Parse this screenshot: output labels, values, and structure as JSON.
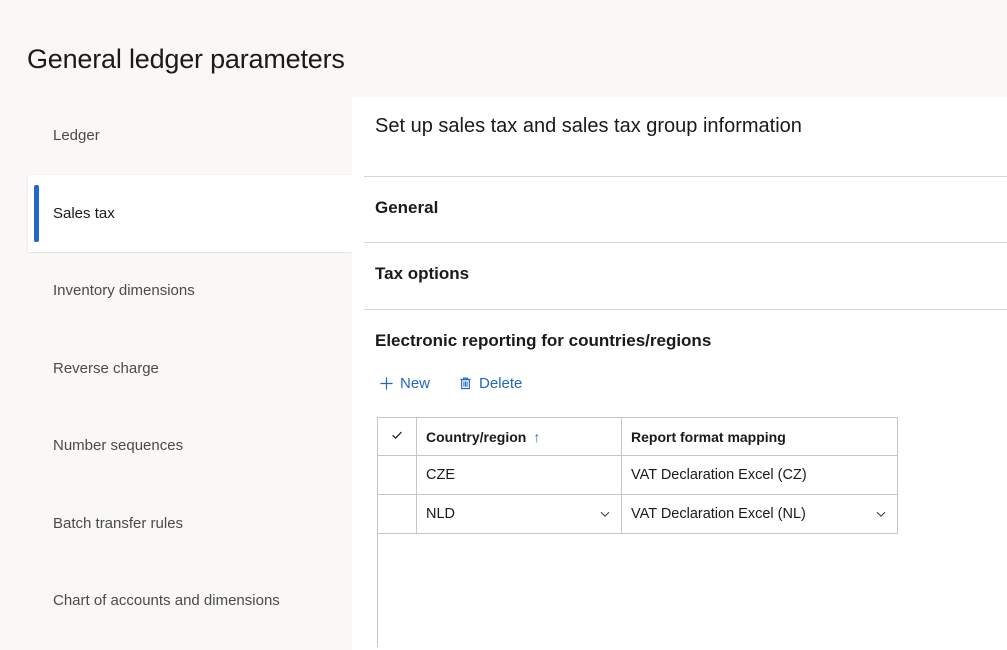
{
  "page_title": "General ledger parameters",
  "sidebar": {
    "items": [
      {
        "label": "Ledger",
        "selected": false
      },
      {
        "label": "Sales tax",
        "selected": true
      },
      {
        "label": "Inventory dimensions",
        "selected": false
      },
      {
        "label": "Reverse charge",
        "selected": false
      },
      {
        "label": "Number sequences",
        "selected": false
      },
      {
        "label": "Batch transfer rules",
        "selected": false
      },
      {
        "label": "Chart of accounts and dimensions",
        "selected": false
      }
    ]
  },
  "main": {
    "title": "Set up sales tax and sales tax group information",
    "sections": [
      {
        "title": "General"
      },
      {
        "title": "Tax options"
      },
      {
        "title": "Electronic reporting for countries/regions"
      }
    ],
    "toolbar": {
      "new_label": "New",
      "new_icon": "plus-icon",
      "delete_label": "Delete",
      "delete_icon": "trash-icon"
    },
    "grid": {
      "select_all_icon": "checkmark-icon",
      "columns": [
        {
          "label": "Country/region",
          "sort": "ascending",
          "sort_glyph": "↑"
        },
        {
          "label": "Report format mapping",
          "sort": "none",
          "sort_glyph": ""
        }
      ],
      "rows": [
        {
          "checked": false,
          "selected": false,
          "country_region": "CZE",
          "report_format_mapping": "VAT Declaration Excel (CZ)"
        },
        {
          "checked": true,
          "selected": true,
          "country_region": "NLD",
          "report_format_mapping": "VAT Declaration Excel (NL)"
        }
      ]
    }
  },
  "colors": {
    "accent": "#2266cc",
    "selected_row_bg": "#d6e2f9",
    "page_bg": "#f9f8f7",
    "panel_bg": "#ffffff",
    "grid_border": "#c8c6c4"
  }
}
